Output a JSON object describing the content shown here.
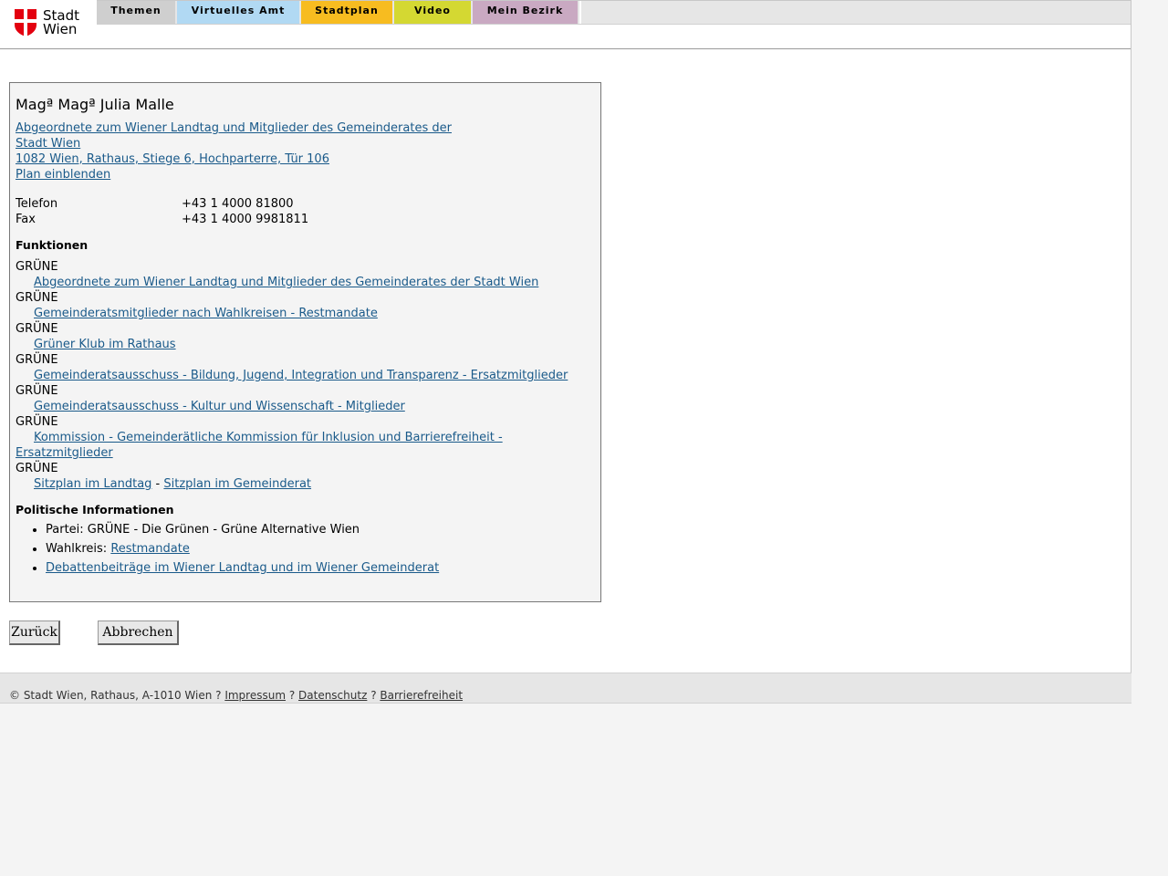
{
  "header": {
    "logo_line1": "Stadt",
    "logo_line2": "Wien",
    "tabs": [
      "Themen",
      "Virtuelles Amt",
      "Stadtplan",
      "Video",
      "Mein Bezirk"
    ]
  },
  "person": {
    "name": "Magª Magª Julia Malle",
    "org_line1": "Abgeordnete zum Wiener Landtag und Mitglieder des Gemeinderates der",
    "org_line2": "Stadt Wien ",
    "address": "1082 Wien, Rathaus, Stiege 6, Hochparterre, Tür 106",
    "plan_link": "Plan einblenden",
    "phone_label": "Telefon",
    "phone": "+43 1 4000 81800",
    "fax_label": "Fax",
    "fax": "+43 1 4000 9981811"
  },
  "functions": {
    "heading": "Funktionen",
    "items": [
      {
        "party": "GRÜNE",
        "link": "Abgeordnete zum Wiener Landtag und Mitglieder des Gemeinderates der Stadt Wien"
      },
      {
        "party": "GRÜNE",
        "link": "Gemeinderatsmitglieder nach Wahlkreisen - Restmandate"
      },
      {
        "party": "GRÜNE",
        "link": "Grüner Klub im Rathaus"
      },
      {
        "party": "GRÜNE",
        "link": "Gemeinderatsausschuss - Bildung, Jugend, Integration und Transparenz - Ersatzmitglieder"
      },
      {
        "party": "GRÜNE",
        "link": "Gemeinderatsausschuss - Kultur und Wissenschaft - Mitglieder"
      },
      {
        "party": "GRÜNE",
        "link": "Kommission - Gemeinderätliche Kommission für Inklusion und Barrierefreiheit - Ersatzmitglieder"
      }
    ],
    "last_party": "GRÜNE",
    "seat_link1": "Sitzplan im Landtag",
    "seat_sep": " - ",
    "seat_link2": "Sitzplan im Gemeinderat"
  },
  "political": {
    "heading": "Politische Informationen",
    "party_text": "Partei: GRÜNE - Die Grünen - Grüne Alternative Wien",
    "district_label": "Wahlkreis: ",
    "district_link": "Restmandate",
    "debates_link": "Debattenbeiträge im Wiener Landtag und im Wiener Gemeinderat"
  },
  "buttons": {
    "back": "Zurück",
    "cancel": "Abbrechen"
  },
  "footer": {
    "copyright": "© Stadt Wien, Rathaus, A-1010 Wien ? ",
    "impressum": "Impressum",
    "sep1": " ? ",
    "datenschutz": "Datenschutz",
    "sep2": " ? ",
    "barrierefreiheit": "Barrierefreiheit"
  },
  "colors": {
    "tab_themen": "#cfcfcf",
    "tab_virtuelles_amt": "#b1d9f3",
    "tab_stadtplan": "#f7bc20",
    "tab_video": "#d4d832",
    "tab_mein_bezirk": "#c9a9c2",
    "link": "#1a5a8a",
    "brand_red": "#e3000f"
  }
}
